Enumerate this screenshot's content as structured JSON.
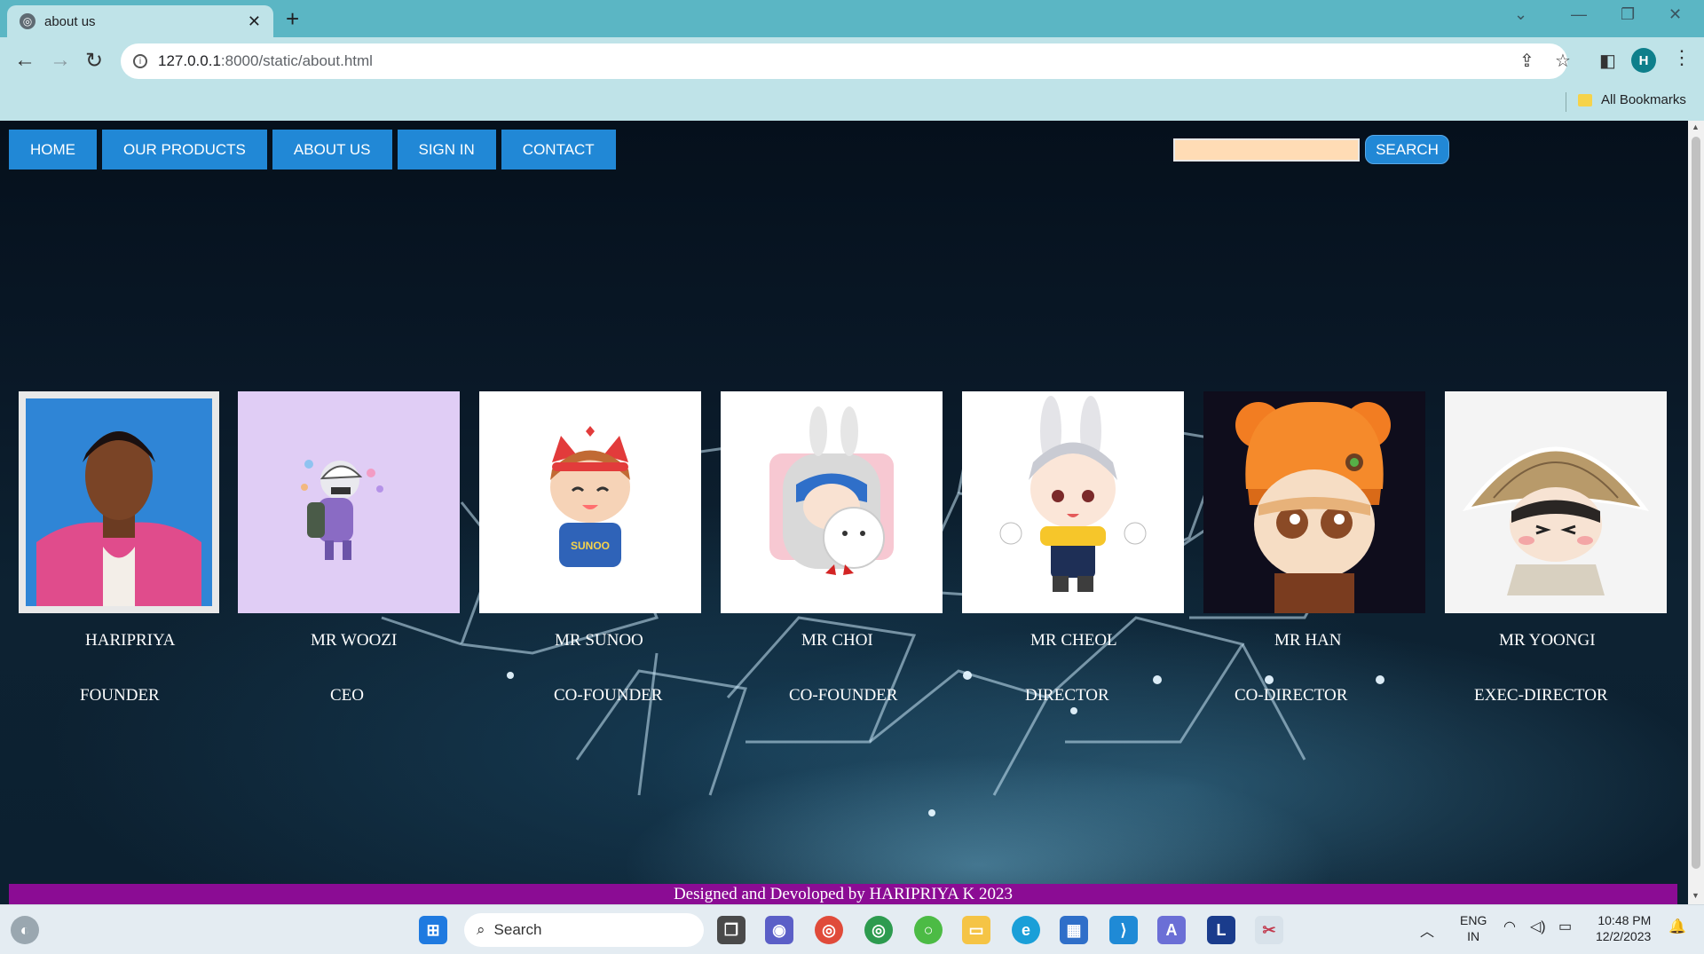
{
  "browser": {
    "tab_title": "about us",
    "url_host": "127.0.0.1",
    "url_path": ":8000/static/about.html",
    "profile_initial": "H",
    "bookmarks_label": "All Bookmarks"
  },
  "nav": {
    "items": [
      {
        "label": "HOME"
      },
      {
        "label": "OUR PRODUCTS"
      },
      {
        "label": "ABOUT US"
      },
      {
        "label": "SIGN IN"
      },
      {
        "label": "CONTACT"
      }
    ],
    "search_value": "",
    "search_button": "SEARCH"
  },
  "team": [
    {
      "name": "HARIPRIYA",
      "role": "FOUNDER"
    },
    {
      "name": "MR WOOZI",
      "role": "CEO"
    },
    {
      "name": "MR SUNOO",
      "role": "CO-FOUNDER"
    },
    {
      "name": "MR CHOI",
      "role": "CO-FOUNDER"
    },
    {
      "name": "MR CHEOL",
      "role": "DIRECTOR"
    },
    {
      "name": "MR HAN",
      "role": "CO-DIRECTOR"
    },
    {
      "name": "MR YOONGI",
      "role": "EXEC-DIRECTOR"
    }
  ],
  "footer": {
    "text": "Designed and Devoloped by HARIPRIYA K 2023"
  },
  "taskbar": {
    "search_label": "Search",
    "lang_top": "ENG",
    "lang_bottom": "IN",
    "time": "10:48 PM",
    "date": "12/2/2023"
  },
  "colors": {
    "nav_button": "#2188d6",
    "footer": "#8b0c94",
    "search_box": "#ffdcb5",
    "chrome_tab_strip": "#5bb6c4",
    "chrome_toolbar": "#bfe3e8"
  }
}
